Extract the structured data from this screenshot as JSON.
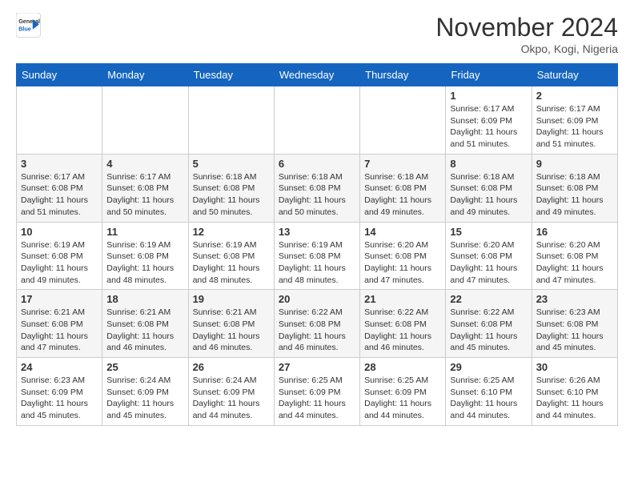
{
  "header": {
    "logo_general": "General",
    "logo_blue": "Blue",
    "month_title": "November 2024",
    "location": "Okpo, Kogi, Nigeria"
  },
  "days_of_week": [
    "Sunday",
    "Monday",
    "Tuesday",
    "Wednesday",
    "Thursday",
    "Friday",
    "Saturday"
  ],
  "weeks": [
    [
      {
        "day": "",
        "info": ""
      },
      {
        "day": "",
        "info": ""
      },
      {
        "day": "",
        "info": ""
      },
      {
        "day": "",
        "info": ""
      },
      {
        "day": "",
        "info": ""
      },
      {
        "day": "1",
        "info": "Sunrise: 6:17 AM\nSunset: 6:09 PM\nDaylight: 11 hours and 51 minutes."
      },
      {
        "day": "2",
        "info": "Sunrise: 6:17 AM\nSunset: 6:09 PM\nDaylight: 11 hours and 51 minutes."
      }
    ],
    [
      {
        "day": "3",
        "info": "Sunrise: 6:17 AM\nSunset: 6:08 PM\nDaylight: 11 hours and 51 minutes."
      },
      {
        "day": "4",
        "info": "Sunrise: 6:17 AM\nSunset: 6:08 PM\nDaylight: 11 hours and 50 minutes."
      },
      {
        "day": "5",
        "info": "Sunrise: 6:18 AM\nSunset: 6:08 PM\nDaylight: 11 hours and 50 minutes."
      },
      {
        "day": "6",
        "info": "Sunrise: 6:18 AM\nSunset: 6:08 PM\nDaylight: 11 hours and 50 minutes."
      },
      {
        "day": "7",
        "info": "Sunrise: 6:18 AM\nSunset: 6:08 PM\nDaylight: 11 hours and 49 minutes."
      },
      {
        "day": "8",
        "info": "Sunrise: 6:18 AM\nSunset: 6:08 PM\nDaylight: 11 hours and 49 minutes."
      },
      {
        "day": "9",
        "info": "Sunrise: 6:18 AM\nSunset: 6:08 PM\nDaylight: 11 hours and 49 minutes."
      }
    ],
    [
      {
        "day": "10",
        "info": "Sunrise: 6:19 AM\nSunset: 6:08 PM\nDaylight: 11 hours and 49 minutes."
      },
      {
        "day": "11",
        "info": "Sunrise: 6:19 AM\nSunset: 6:08 PM\nDaylight: 11 hours and 48 minutes."
      },
      {
        "day": "12",
        "info": "Sunrise: 6:19 AM\nSunset: 6:08 PM\nDaylight: 11 hours and 48 minutes."
      },
      {
        "day": "13",
        "info": "Sunrise: 6:19 AM\nSunset: 6:08 PM\nDaylight: 11 hours and 48 minutes."
      },
      {
        "day": "14",
        "info": "Sunrise: 6:20 AM\nSunset: 6:08 PM\nDaylight: 11 hours and 47 minutes."
      },
      {
        "day": "15",
        "info": "Sunrise: 6:20 AM\nSunset: 6:08 PM\nDaylight: 11 hours and 47 minutes."
      },
      {
        "day": "16",
        "info": "Sunrise: 6:20 AM\nSunset: 6:08 PM\nDaylight: 11 hours and 47 minutes."
      }
    ],
    [
      {
        "day": "17",
        "info": "Sunrise: 6:21 AM\nSunset: 6:08 PM\nDaylight: 11 hours and 47 minutes."
      },
      {
        "day": "18",
        "info": "Sunrise: 6:21 AM\nSunset: 6:08 PM\nDaylight: 11 hours and 46 minutes."
      },
      {
        "day": "19",
        "info": "Sunrise: 6:21 AM\nSunset: 6:08 PM\nDaylight: 11 hours and 46 minutes."
      },
      {
        "day": "20",
        "info": "Sunrise: 6:22 AM\nSunset: 6:08 PM\nDaylight: 11 hours and 46 minutes."
      },
      {
        "day": "21",
        "info": "Sunrise: 6:22 AM\nSunset: 6:08 PM\nDaylight: 11 hours and 46 minutes."
      },
      {
        "day": "22",
        "info": "Sunrise: 6:22 AM\nSunset: 6:08 PM\nDaylight: 11 hours and 45 minutes."
      },
      {
        "day": "23",
        "info": "Sunrise: 6:23 AM\nSunset: 6:08 PM\nDaylight: 11 hours and 45 minutes."
      }
    ],
    [
      {
        "day": "24",
        "info": "Sunrise: 6:23 AM\nSunset: 6:09 PM\nDaylight: 11 hours and 45 minutes."
      },
      {
        "day": "25",
        "info": "Sunrise: 6:24 AM\nSunset: 6:09 PM\nDaylight: 11 hours and 45 minutes."
      },
      {
        "day": "26",
        "info": "Sunrise: 6:24 AM\nSunset: 6:09 PM\nDaylight: 11 hours and 44 minutes."
      },
      {
        "day": "27",
        "info": "Sunrise: 6:25 AM\nSunset: 6:09 PM\nDaylight: 11 hours and 44 minutes."
      },
      {
        "day": "28",
        "info": "Sunrise: 6:25 AM\nSunset: 6:09 PM\nDaylight: 11 hours and 44 minutes."
      },
      {
        "day": "29",
        "info": "Sunrise: 6:25 AM\nSunset: 6:10 PM\nDaylight: 11 hours and 44 minutes."
      },
      {
        "day": "30",
        "info": "Sunrise: 6:26 AM\nSunset: 6:10 PM\nDaylight: 11 hours and 44 minutes."
      }
    ]
  ]
}
